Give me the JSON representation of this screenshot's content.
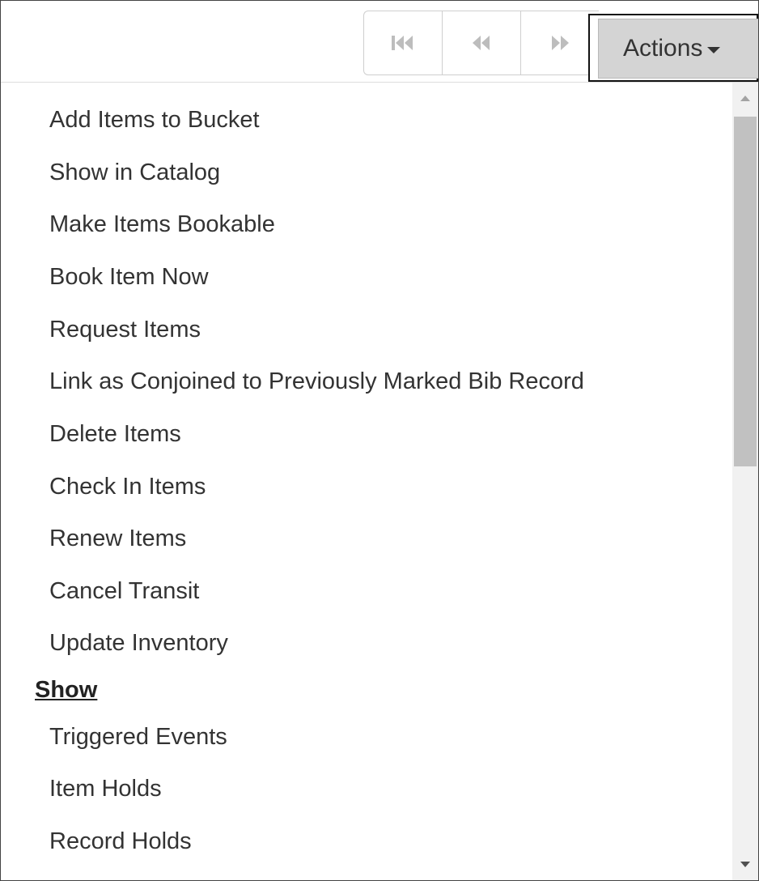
{
  "toolbar": {
    "nav_buttons": [
      {
        "name": "first-page",
        "icon": "skip-to-start-icon"
      },
      {
        "name": "previous-page",
        "icon": "rewind-icon"
      },
      {
        "name": "next-page",
        "icon": "fast-forward-icon"
      }
    ],
    "actions_label": "Actions",
    "actions_icon": "caret-down-icon"
  },
  "menu": {
    "items": [
      "Add Items to Bucket",
      "Show in Catalog",
      "Make Items Bookable",
      "Book Item Now",
      "Request Items",
      "Link as Conjoined to Previously Marked Bib Record",
      "Delete Items",
      "Check In Items",
      "Renew Items",
      "Cancel Transit",
      "Update Inventory"
    ],
    "section_header": "Show",
    "show_items": [
      "Triggered Events",
      "Item Holds",
      "Record Holds"
    ]
  },
  "colors": {
    "menu_text": "#333333",
    "actions_bg": "#d4d4d4",
    "nav_icon": "#bdbdbd",
    "scroll_thumb": "#c1c1c1"
  }
}
